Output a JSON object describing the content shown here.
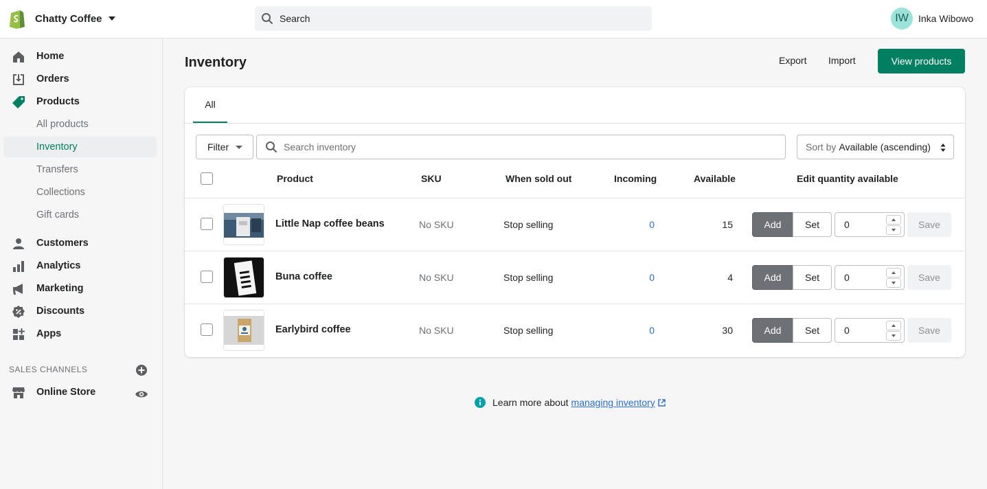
{
  "colors": {
    "accent": "#008060",
    "link": "#2c6ecb",
    "avatar_bg": "#9be3d9"
  },
  "topbar": {
    "store_name": "Chatty Coffee",
    "search_placeholder": "Search",
    "user_initials": "IW",
    "user_name": "Inka Wibowo"
  },
  "sidebar": {
    "items": [
      {
        "label": "Home",
        "icon": "home-icon"
      },
      {
        "label": "Orders",
        "icon": "orders-icon"
      },
      {
        "label": "Products",
        "icon": "tag-icon"
      },
      {
        "label": "All products"
      },
      {
        "label": "Inventory",
        "active": true
      },
      {
        "label": "Transfers"
      },
      {
        "label": "Collections"
      },
      {
        "label": "Gift cards"
      },
      {
        "label": "Customers",
        "icon": "person-icon"
      },
      {
        "label": "Analytics",
        "icon": "bar-chart-icon"
      },
      {
        "label": "Marketing",
        "icon": "megaphone-icon"
      },
      {
        "label": "Discounts",
        "icon": "discount-badge-icon"
      },
      {
        "label": "Apps",
        "icon": "apps-grid-icon"
      }
    ],
    "sales_channels_label": "SALES CHANNELS",
    "online_store_label": "Online Store"
  },
  "page": {
    "title": "Inventory",
    "export_label": "Export",
    "import_label": "Import",
    "view_products_label": "View products"
  },
  "card": {
    "tab_all": "All",
    "filter_label": "Filter",
    "search_placeholder": "Search inventory",
    "sort_prefix": "Sort by",
    "sort_value": "Available (ascending)",
    "columns": {
      "product": "Product",
      "sku": "SKU",
      "when_sold_out": "When sold out",
      "incoming": "Incoming",
      "available": "Available",
      "edit_qty": "Edit quantity available"
    },
    "rows": [
      {
        "name": "Little Nap coffee beans",
        "sku": "No SKU",
        "sold_out": "Stop selling",
        "incoming": "0",
        "available": "15",
        "add": "Add",
        "set": "Set",
        "qty": "0",
        "save": "Save"
      },
      {
        "name": "Buna coffee",
        "sku": "No SKU",
        "sold_out": "Stop selling",
        "incoming": "0",
        "available": "4",
        "add": "Add",
        "set": "Set",
        "qty": "0",
        "save": "Save"
      },
      {
        "name": "Earlybird coffee",
        "sku": "No SKU",
        "sold_out": "Stop selling",
        "incoming": "0",
        "available": "30",
        "add": "Add",
        "set": "Set",
        "qty": "0",
        "save": "Save"
      }
    ]
  },
  "footer": {
    "learn_text": "Learn more about",
    "link_text": "managing inventory"
  }
}
